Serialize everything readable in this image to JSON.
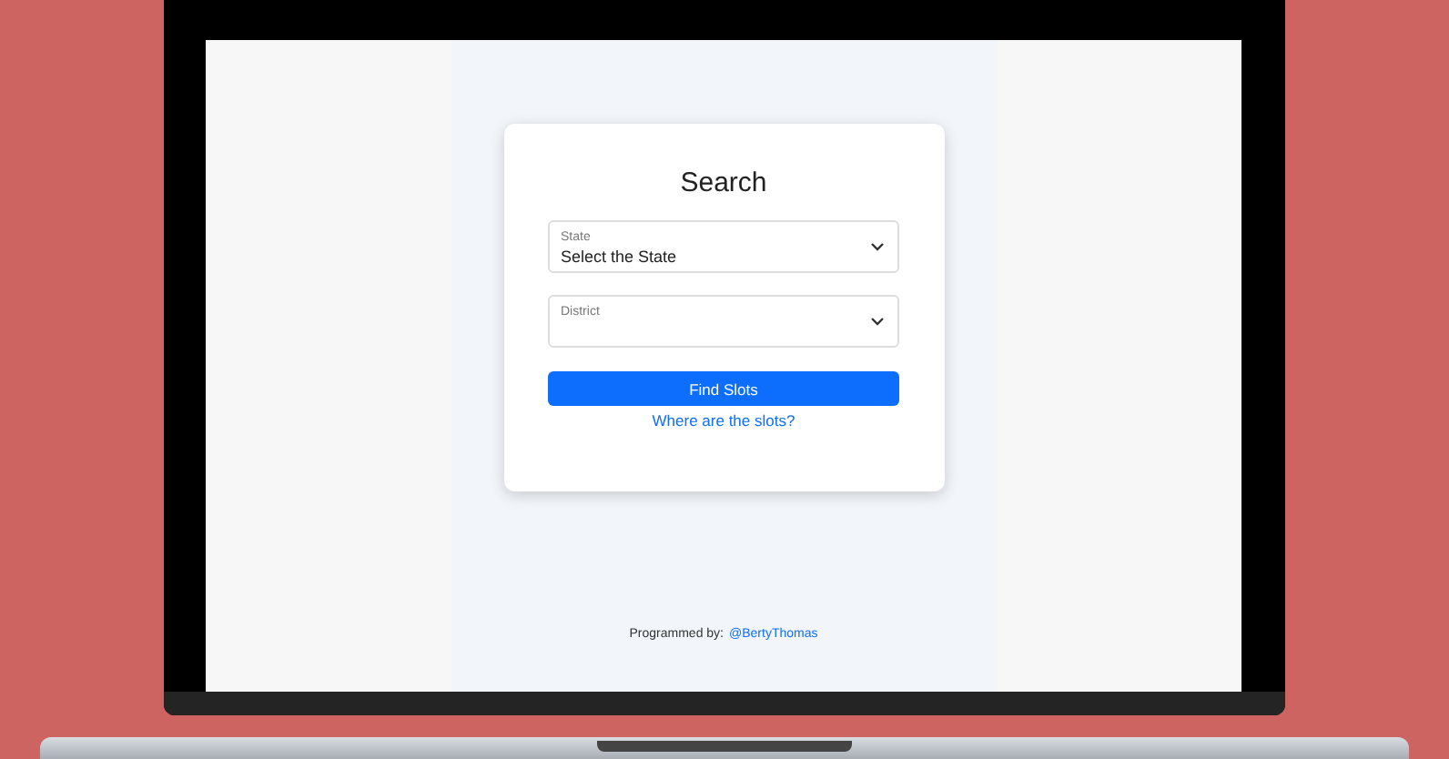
{
  "search_card": {
    "title": "Search",
    "fields": [
      {
        "label": "State",
        "value": "Select the State"
      },
      {
        "label": "District"
      }
    ],
    "button": "Find Slots",
    "link": "Where are the slots?"
  },
  "footer": {
    "text": "Programmed by:",
    "handle": "@BertyThomas"
  }
}
